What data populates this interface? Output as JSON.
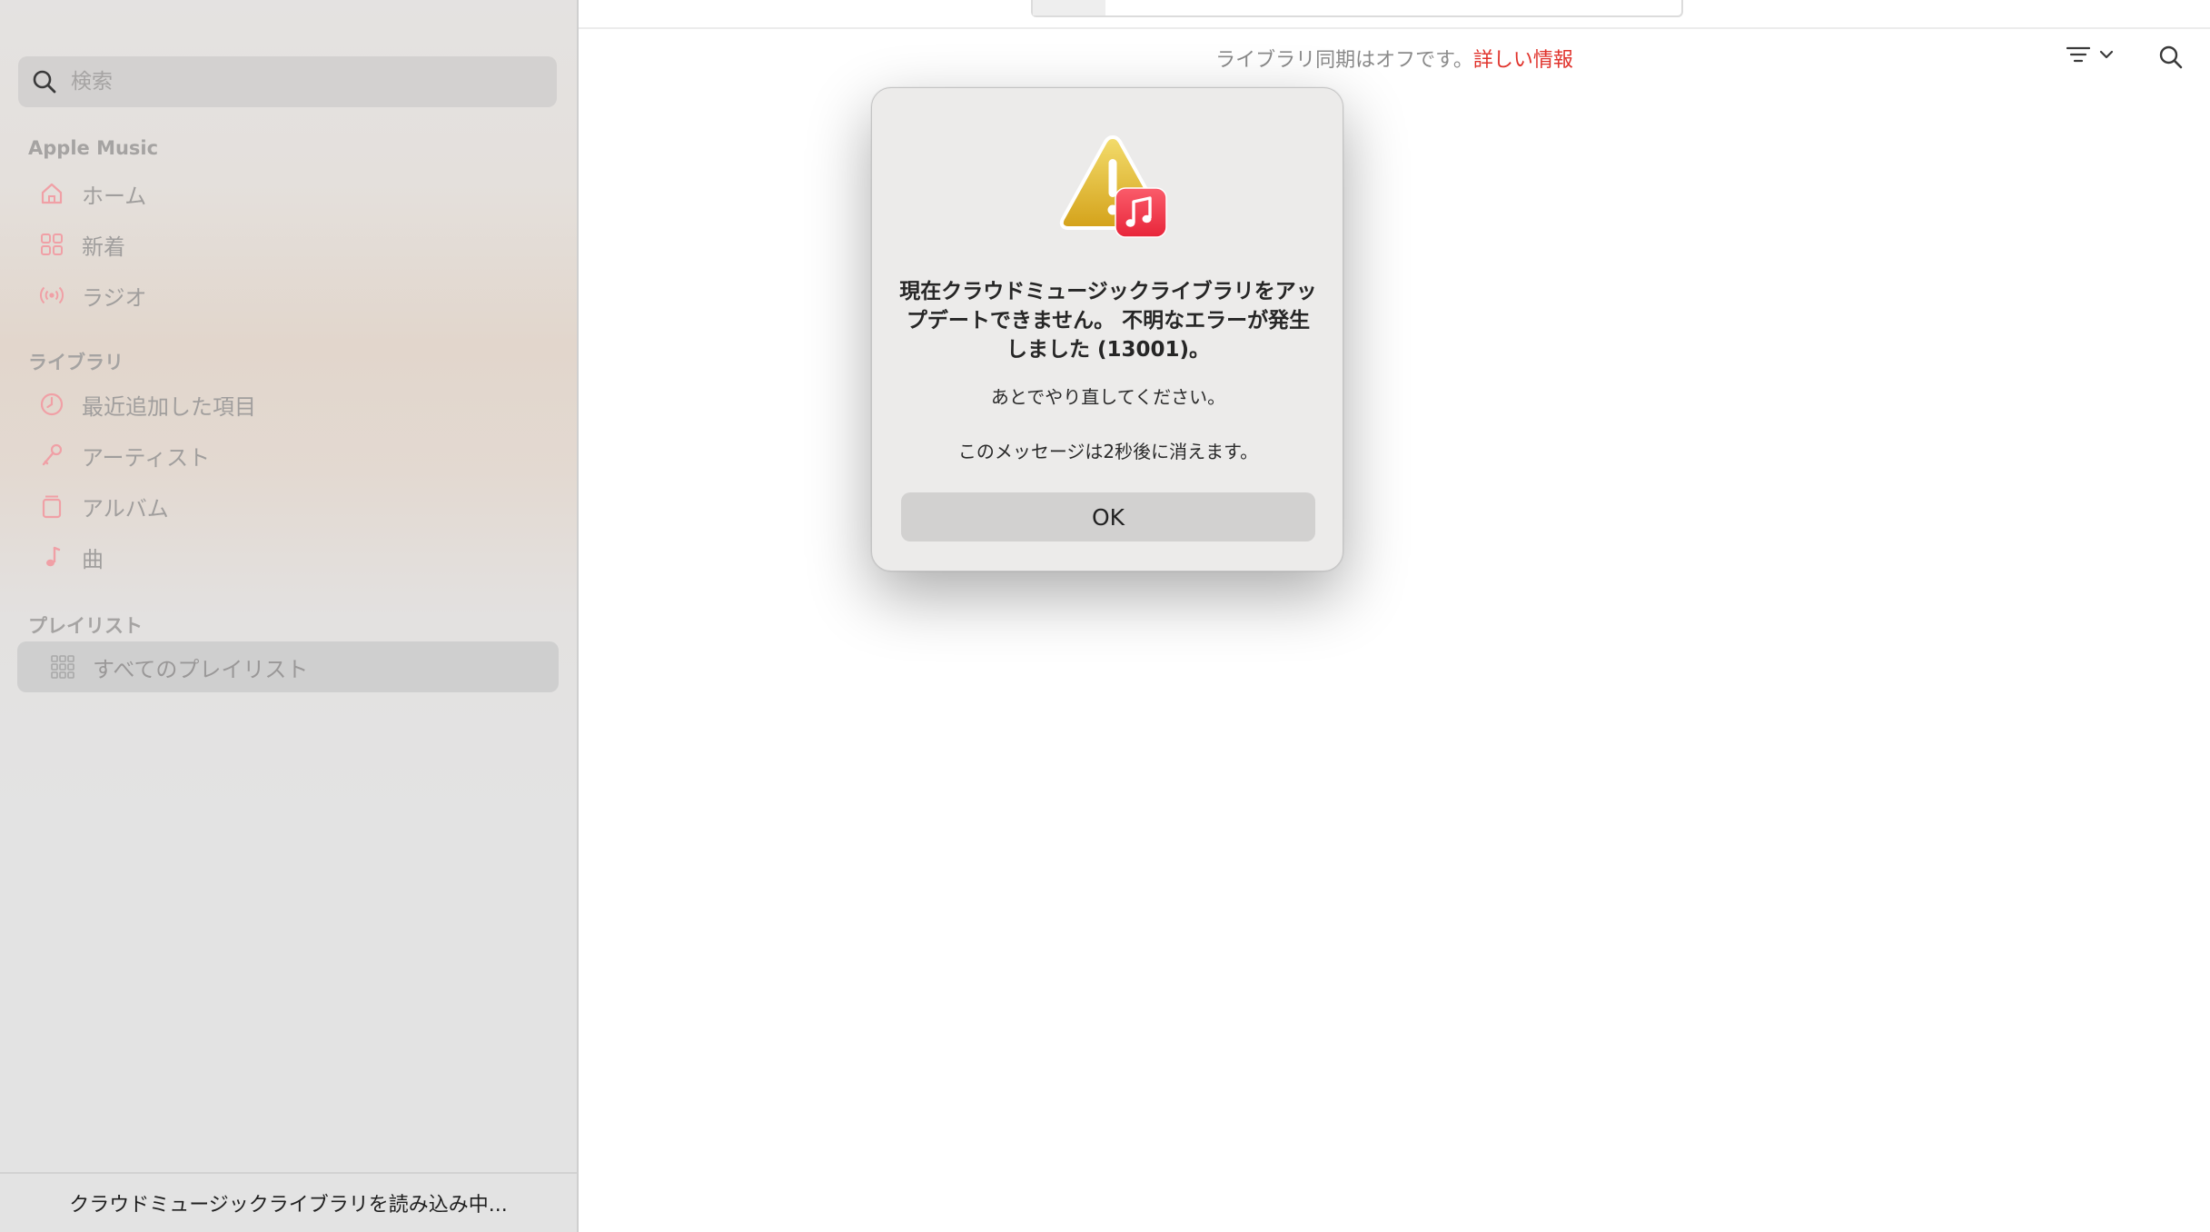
{
  "sidebar": {
    "search_placeholder": "検索",
    "sections": {
      "apple_music": "Apple Music",
      "library": "ライブラリ",
      "playlists": "プレイリスト"
    },
    "apple_music_items": [
      {
        "label": "ホーム",
        "icon": "home-icon"
      },
      {
        "label": "新着",
        "icon": "grid-icon"
      },
      {
        "label": "ラジオ",
        "icon": "radio-icon"
      }
    ],
    "library_items": [
      {
        "label": "最近追加した項目",
        "icon": "clock-icon"
      },
      {
        "label": "アーティスト",
        "icon": "microphone-icon"
      },
      {
        "label": "アルバム",
        "icon": "album-icon"
      },
      {
        "label": "曲",
        "icon": "music-note-icon"
      }
    ],
    "playlist_items": [
      {
        "label": "すべてのプレイリスト",
        "icon": "playlists-grid-icon",
        "selected": true
      }
    ],
    "footer_status": "クラウドミュージックライブラリを読み込み中..."
  },
  "main": {
    "sync_message": "ライブラリ同期はオフです。",
    "sync_link": "詳しい情報"
  },
  "dialog": {
    "title": "現在クラウドミュージックライブラリをアップデートできません。 不明なエラーが発生しました (13001)。",
    "message": "あとでやり直してください。",
    "countdown": "このメッセージは2秒後に消えます。",
    "ok_label": "OK"
  },
  "colors": {
    "accent_red": "#e0322b",
    "sidebar_icon_pink": "#f0a0a6",
    "music_badge": "#f2404e"
  }
}
